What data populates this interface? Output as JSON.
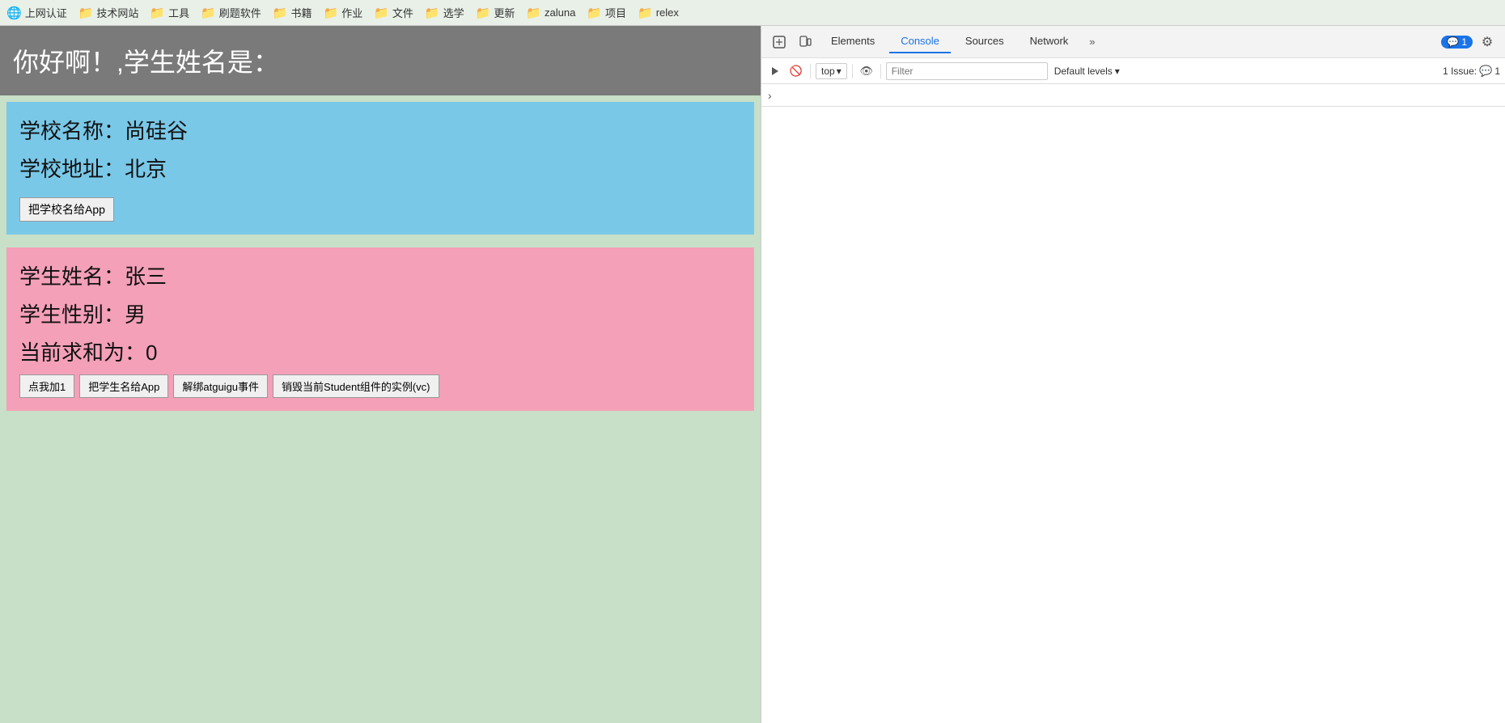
{
  "bookmarks": {
    "items": [
      {
        "label": "上网认证",
        "icon": "🌐"
      },
      {
        "label": "技术网站",
        "icon": "📁"
      },
      {
        "label": "工具",
        "icon": "📁"
      },
      {
        "label": "刷题软件",
        "icon": "📁"
      },
      {
        "label": "书籍",
        "icon": "📁"
      },
      {
        "label": "作业",
        "icon": "📁"
      },
      {
        "label": "文件",
        "icon": "📁"
      },
      {
        "label": "选学",
        "icon": "📁"
      },
      {
        "label": "更新",
        "icon": "📁"
      },
      {
        "label": "zaluna",
        "icon": "📁"
      },
      {
        "label": "项目",
        "icon": "📁"
      },
      {
        "label": "relex",
        "icon": "📁"
      }
    ]
  },
  "page": {
    "header_text": "你好啊！,学生姓名是：",
    "school": {
      "name_label": "学校名称：尚硅谷",
      "address_label": "学校地址：北京",
      "button_label": "把学校名给App"
    },
    "student": {
      "name_label": "学生姓名：张三",
      "gender_label": "学生性别：男",
      "sum_label": "当前求和为：0",
      "buttons": [
        {
          "label": "点我加1"
        },
        {
          "label": "把学生名给App"
        },
        {
          "label": "解绑atguigu事件"
        },
        {
          "label": "销毁当前Student组件的实例(vc)"
        }
      ]
    }
  },
  "devtools": {
    "tabs": [
      {
        "label": "Elements",
        "active": false
      },
      {
        "label": "Console",
        "active": true
      },
      {
        "label": "Sources",
        "active": false
      },
      {
        "label": "Network",
        "active": false
      }
    ],
    "more_label": "»",
    "badge_label": "1",
    "top_label": "top",
    "filter_placeholder": "Filter",
    "default_levels_label": "Default levels",
    "issues_label": "1 Issue:",
    "issues_count": "1"
  }
}
